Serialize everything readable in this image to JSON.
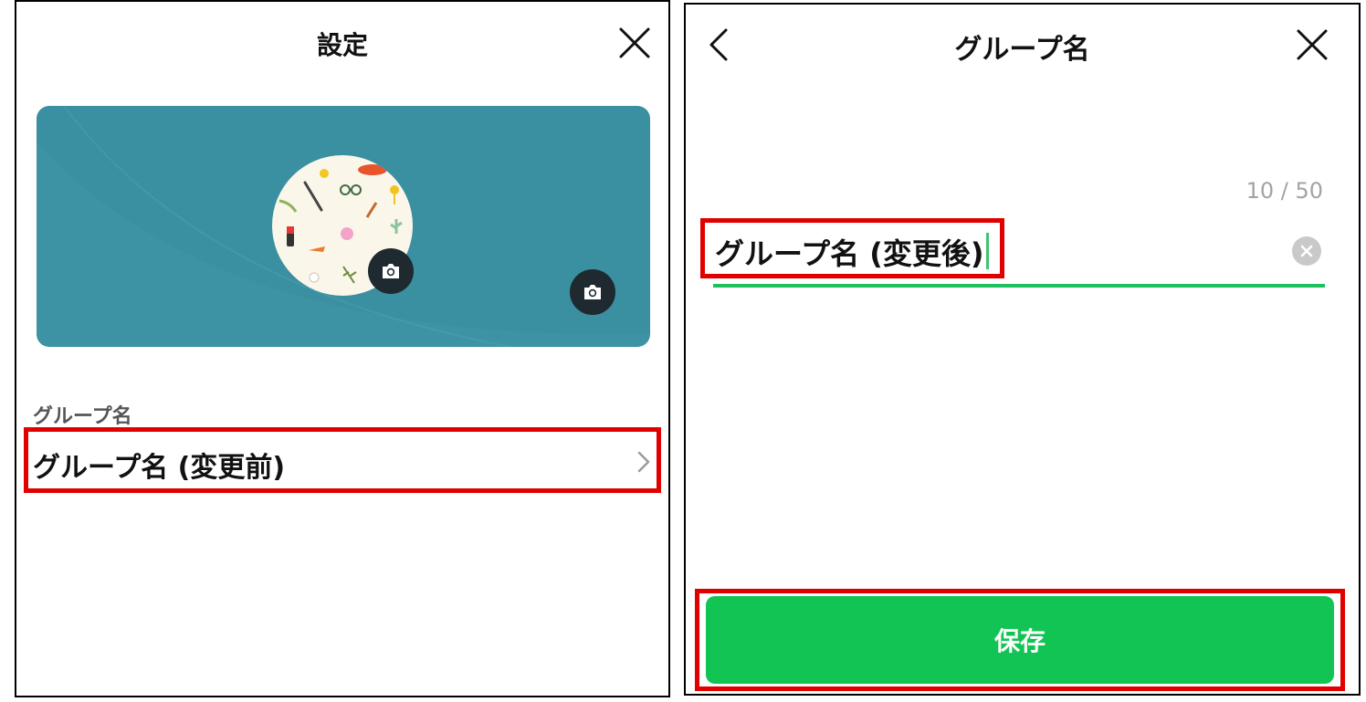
{
  "left": {
    "title": "設定",
    "section_label": "グループ名",
    "group_name": "グループ名 (変更前)",
    "icons": {
      "close": "close-icon",
      "avatar_camera": "camera-icon",
      "cover_camera": "camera-icon",
      "chevron": "chevron-right-icon"
    },
    "cover_color": "#3a8fa0"
  },
  "right": {
    "title": "グループ名",
    "counter": "10 / 50",
    "input_value": "グループ名 (変更後)",
    "save_label": "保存",
    "icons": {
      "back": "chevron-left-icon",
      "close": "close-icon",
      "clear": "clear-input-icon"
    },
    "accent_color": "#12c453",
    "highlight_color": "#e00000"
  }
}
